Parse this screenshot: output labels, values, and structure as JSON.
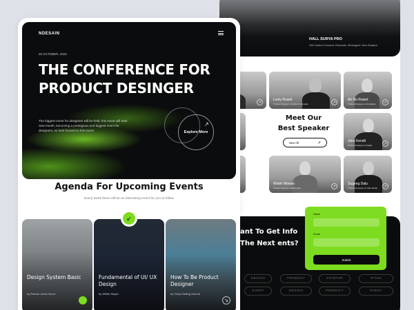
{
  "brand": "NDESAIN",
  "hero": {
    "date": "20 OCTOBER, 2022",
    "title": "THE CONFERENCE FOR PRODUCT DESINGER",
    "description": "The biggest event for designers will be held, this event will start next month, becoming a prestigious and biggest event for designers, so look forward to this event.",
    "explore_label": "Explore More"
  },
  "agenda": {
    "title": "Agenda For Upcoming Events",
    "subtitle": "Every week there will be an interesting event for you to follow",
    "events": [
      {
        "title": "Design System Basic",
        "by": "by Ramon Jerok Hunut"
      },
      {
        "title": "Fundamental of UI/ UX Design",
        "by": "by Wilder Mayer"
      },
      {
        "title": "How To Be Product Designer",
        "by": "by Vicky Gading Ganum"
      }
    ]
  },
  "hall": {
    "name": "HALL SURYA PRO",
    "address": "206 Carlton Crescent, Riverside, Whangarei, New Zealand"
  },
  "speakers": {
    "title": "Meet Our Best Speaker",
    "see_all": "See All",
    "people": [
      {
        "name": "",
        "role": ""
      },
      {
        "name": "Lesty Ruwet",
        "role": "Product Designer at Nolimit Indonesia"
      },
      {
        "name": "Ari No Ruwet",
        "role": "Product Designer at Sorakasa"
      },
      {
        "name": "",
        "role": ""
      },
      {
        "name": "Joko Kendil",
        "role": "Product Designer at Salad"
      },
      {
        "name": "",
        "role": ""
      },
      {
        "name": "Wiwin Wawan",
        "role": "Product Designer at Bhinneka"
      },
      {
        "name": "Sugeng Dalu",
        "role": "Product Designer at Yallo Studio"
      }
    ]
  },
  "cta": {
    "text": "ant To Get Info The Next ents?"
  },
  "tags": [
    "DESIGN",
    "PRODUCT",
    "STARTUP",
    "STUDI",
    "EVENT",
    "DESIGN",
    "PRODUCT",
    "EVENT"
  ],
  "form": {
    "name_label": "Name",
    "email_label": "Email",
    "submit_label": "Submit"
  },
  "colors": {
    "accent": "#7ddc1f",
    "dark": "#0b0c0d"
  }
}
